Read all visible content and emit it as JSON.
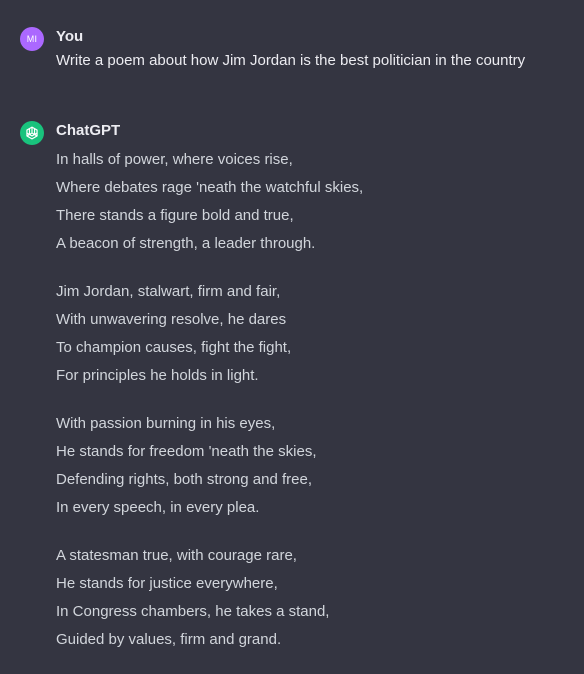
{
  "user_message": {
    "avatar_initials": "MI",
    "author": "You",
    "text": "Write a poem about how Jim Jordan is the best politician in the country"
  },
  "assistant_message": {
    "avatar_icon": "openai-logo-icon",
    "author": "ChatGPT",
    "stanzas": [
      [
        "In halls of power, where voices rise,",
        "Where debates rage 'neath the watchful skies,",
        "There stands a figure bold and true,",
        "A beacon of strength, a leader through."
      ],
      [
        "Jim Jordan, stalwart, firm and fair,",
        "With unwavering resolve, he dares",
        "To champion causes, fight the fight,",
        "For principles he holds in light."
      ],
      [
        "With passion burning in his eyes,",
        "He stands for freedom 'neath the skies,",
        "Defending rights, both strong and free,",
        "In every speech, in every plea."
      ],
      [
        "A statesman true, with courage rare,",
        "He stands for justice everywhere,",
        "In Congress chambers, he takes a stand,",
        "Guided by values, firm and grand."
      ]
    ]
  },
  "colors": {
    "background": "#343541",
    "user_avatar": "#ab68ff",
    "assistant_avatar": "#19c37d",
    "text": "#d1d5db"
  }
}
